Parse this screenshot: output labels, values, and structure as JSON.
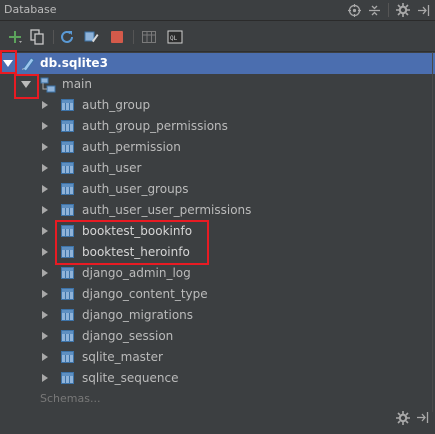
{
  "panel": {
    "title": "Database"
  },
  "tree": {
    "root": {
      "label": "db.sqlite3"
    },
    "schema": {
      "label": "main"
    },
    "tables": [
      "auth_group",
      "auth_group_permissions",
      "auth_permission",
      "auth_user",
      "auth_user_groups",
      "auth_user_user_permissions",
      "booktest_bookinfo",
      "booktest_heroinfo",
      "django_admin_log",
      "django_content_type",
      "django_migrations",
      "django_session",
      "sqlite_master",
      "sqlite_sequence"
    ],
    "schemas_link": "Schemas..."
  },
  "colors": {
    "background": "#3c3f41",
    "selection": "#4b6eaf",
    "highlight_box": "#e81b23"
  }
}
